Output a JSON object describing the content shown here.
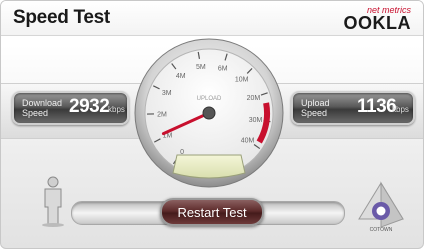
{
  "header": {
    "title": "Speed Test",
    "brand_tagline": "net metrics",
    "brand_name": "OOKLA"
  },
  "download": {
    "label_line1": "Download",
    "label_line2": "Speed",
    "value": "2932",
    "unit": "kbps"
  },
  "upload": {
    "label_line1": "Upload",
    "label_line2": "Speed",
    "value": "1136",
    "unit": "kbps"
  },
  "gauge": {
    "center_label": "UPLOAD",
    "scale": [
      "0",
      "1M",
      "2M",
      "3M",
      "4M",
      "5M",
      "6M",
      "10M",
      "20M",
      "30M",
      "40M"
    ],
    "scale_unit": "",
    "needle_value_kbps": 1136,
    "accent_color": "#c8102e"
  },
  "controls": {
    "restart_label": "Restart Test",
    "progress_fraction": 1.0
  },
  "server": {
    "label": "COTOWN"
  },
  "icons": {
    "client": "person-icon",
    "server": "server-pyramid-icon"
  }
}
